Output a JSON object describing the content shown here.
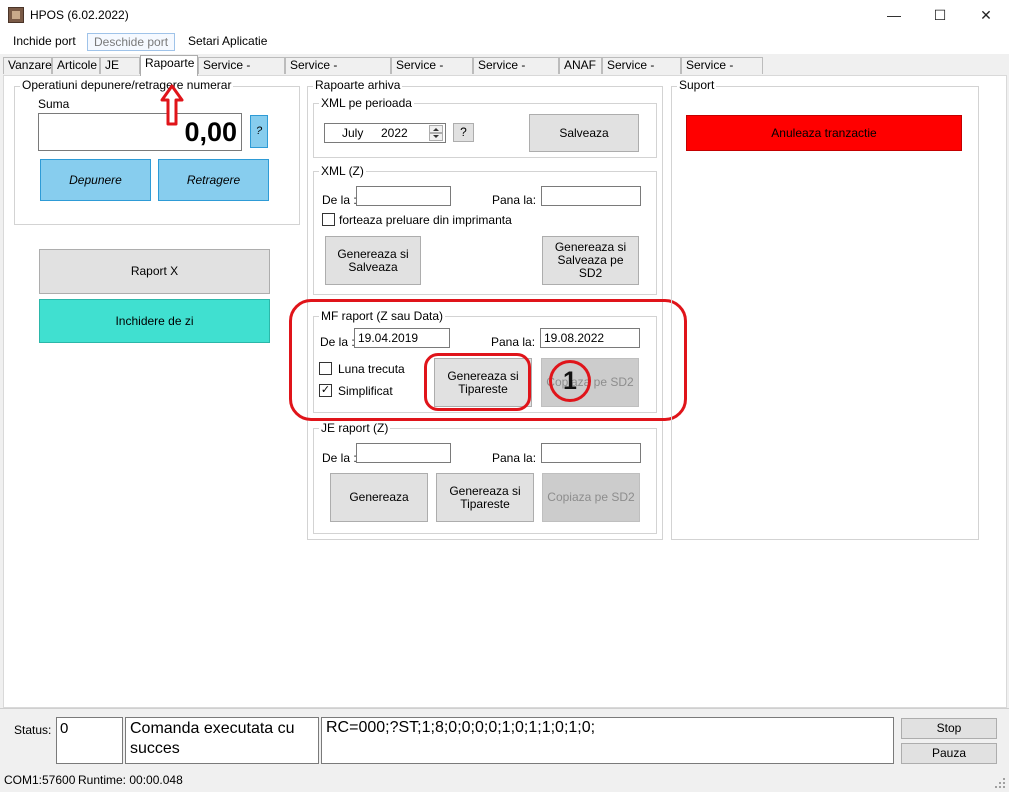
{
  "window": {
    "title": "HPOS (6.02.2022)",
    "min": "—",
    "max": "☐",
    "close": "✕"
  },
  "menu": {
    "close_port": "Inchide port",
    "open_port": "Deschide port",
    "settings": "Setari Aplicatie"
  },
  "tabs": [
    "Vanzare",
    "Articole",
    "JE",
    "Rapoarte",
    "Service - Fisiere",
    "Service - Fiscalizare",
    "Service - Afisaj",
    "Service - Status",
    "ANAF",
    "Service - PBC",
    "Service - Istoric"
  ],
  "cash_ops": {
    "title": "Operatiuni depunere/retragere numerar",
    "sum_label": "Suma",
    "sum_value": "0,00",
    "help": "?",
    "deposit": "Depunere",
    "withdraw": "Retragere"
  },
  "reports_left": {
    "report_x": "Raport X",
    "close_day": "Inchidere de zi"
  },
  "archive": {
    "title": "Rapoarte arhiva",
    "xml_period": {
      "title": "XML pe perioada",
      "month": "July",
      "year": "2022",
      "help": "?",
      "save": "Salveaza"
    },
    "xml_z": {
      "title": "XML (Z)",
      "from_label": "De la :",
      "to_label": "Pana la:",
      "from_value": "",
      "to_value": "",
      "force_label": "forteaza preluare din imprimanta",
      "gen_save": "Genereaza si Salveaza",
      "gen_save_sd2": "Genereaza si Salveaza pe SD2"
    },
    "mf": {
      "title": "MF raport (Z sau Data)",
      "from_label": "De la :",
      "to_label": "Pana la:",
      "from_value": "19.04.2019",
      "to_value": "19.08.2022",
      "last_month": "Luna trecuta",
      "simplified": "Simplificat",
      "simplified_check": "✓",
      "gen_print": "Genereaza si Tipareste",
      "copy_sd2": "Copiaza pe SD2",
      "annotation_number": "1"
    },
    "je": {
      "title": "JE raport (Z)",
      "from_label": "De la :",
      "to_label": "Pana la:",
      "from_value": "",
      "to_value": "",
      "generate": "Genereaza",
      "gen_print": "Genereaza si Tipareste",
      "copy_sd2": "Copiaza pe SD2"
    }
  },
  "support": {
    "title": "Suport",
    "cancel": "Anuleaza tranzactie"
  },
  "status": {
    "label": "Status:",
    "code": "0",
    "message": "Comanda executata cu succes",
    "response": "RC=000;?ST;1;8;0;0;0;0;1;0;1;1;0;1;0;",
    "stop": "Stop",
    "pause": "Pauza"
  },
  "footer": {
    "port": "COM1:57600",
    "runtime": "Runtime: 00:00.048"
  },
  "colors": {
    "cancel": "#ff0000",
    "close_day": "#40e0d0",
    "blue_btn": "#87cdee",
    "annotation": "#e0141a"
  }
}
